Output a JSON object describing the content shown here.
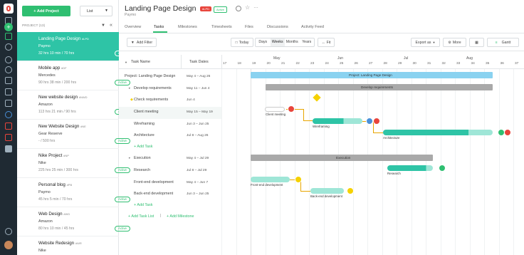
{
  "sidebar_rail": {
    "icons": [
      "logo-icon",
      "home-icon",
      "add-icon",
      "folder-icon",
      "search-icon",
      "user-icon",
      "clock-icon",
      "people-icon",
      "chart-icon",
      "calendar-icon",
      "settings-icon",
      "stop-icon",
      "layers-icon",
      "terminal-icon",
      "info-icon",
      "avatar-icon"
    ]
  },
  "projects_panel": {
    "add_project_label": "+ Add Project",
    "view_label": "List",
    "header": "PROJECT (13)",
    "projects": [
      {
        "name": "Landing Page Design",
        "tag": "#LPD",
        "client": "Paymo",
        "hours": "32 hrs 10 min / 70 hrs",
        "status": "Active"
      },
      {
        "name": "Mobile app",
        "tag": "#DF",
        "client": "Mercedes",
        "hours": "90 hrs 38 min / 200 hrs",
        "status": "Active"
      },
      {
        "name": "New website design",
        "tag": "#NWD",
        "client": "Amazon",
        "hours": "113 hrs 21 min / 90 hrs",
        "status": "Active"
      },
      {
        "name": "New Website Design",
        "tag": "#NE",
        "client": "Gear Reserve",
        "hours": "- / 500 hrs",
        "status": "Active"
      },
      {
        "name": "Nike Project",
        "tag": "#NP",
        "client": "Nike",
        "hours": "225 hrs 25 min / 300 hrs",
        "status": "Active"
      },
      {
        "name": "Personal blog",
        "tag": "#PB",
        "client": "Paymo",
        "hours": "45 hrs 5 min / 70 hrs",
        "status": "Active"
      },
      {
        "name": "Web Design",
        "tag": "#WD",
        "client": "Amazon",
        "hours": "80 hrs 10 min / 45 hrs",
        "status": "Active"
      },
      {
        "name": "Website Redesign",
        "tag": "#WR",
        "client": "Nike",
        "hours": "",
        "status": ""
      }
    ]
  },
  "header": {
    "title": "Landing Page Design",
    "tag": "#LPD",
    "status": "Active",
    "subtitle": "Paymo",
    "tabs": [
      "Overview",
      "Tasks",
      "Milestones",
      "Timesheets",
      "Files",
      "Discussions",
      "Activity Feed"
    ],
    "active_tab": "Tasks"
  },
  "toolbar": {
    "add_filter": "Add Filter",
    "today": "Today",
    "scales": [
      "Days",
      "Weeks",
      "Months",
      "Years"
    ],
    "active_scale": "Weeks",
    "fit": "Fit",
    "export": "Export as",
    "more": "More",
    "view": "Gantt"
  },
  "task_table": {
    "col_name": "Task Name",
    "col_dates": "Task Dates",
    "rows": [
      {
        "name": "Project: Landing Page Design",
        "dates": "May 4 – Aug 26",
        "level": 0
      },
      {
        "name": "Develop requirements",
        "dates": "May 11 – Jun 4",
        "level": 1
      },
      {
        "name": "Check requirements",
        "dates": "Jun 4",
        "level": 2
      },
      {
        "name": "Client meeting",
        "dates": "May 15 – May 19",
        "level": 2
      },
      {
        "name": "Wireframing",
        "dates": "Jun 3 – Jun 25",
        "level": 2
      },
      {
        "name": "Architecture",
        "dates": "Jul 8 – Aug 26",
        "level": 2
      },
      {
        "name": "+ Add Task",
        "dates": "",
        "level": 2
      },
      {
        "name": "Execution",
        "dates": "May 4 – Jul 29",
        "level": 1
      },
      {
        "name": "Research",
        "dates": "Jul 8 – Jul 29",
        "level": 2
      },
      {
        "name": "Front-end development",
        "dates": "May 4 – Jun 7",
        "level": 2
      },
      {
        "name": "Back-end development",
        "dates": "Jun 3 – Jun 25",
        "level": 2
      },
      {
        "name": "+ Add Task",
        "dates": "",
        "level": 2
      }
    ],
    "add_task_list": "+ Add Task List",
    "add_milestone": "+ Add Milestone"
  },
  "gantt": {
    "months": [
      "May",
      "Jun",
      "Jul",
      "Aug"
    ],
    "weeks": [
      "17",
      "18",
      "19",
      "20",
      "21",
      "22",
      "23",
      "24",
      "25",
      "26",
      "27",
      "28",
      "29",
      "30",
      "31",
      "32",
      "33",
      "34",
      "35",
      "36",
      "37"
    ],
    "bar_labels": {
      "project": "Project: Landing Page Design",
      "develop": "Develop requirements",
      "client": "Client meeting",
      "wire": "Wireframing",
      "arch": "Architecture",
      "execution": "Execution",
      "research": "Research",
      "frontend": "Front-end development",
      "backend": "Back-end development"
    },
    "avatars": [
      "AL",
      "AL",
      "JR",
      "GT",
      "AL",
      "GT",
      "AR"
    ],
    "colors": {
      "project": "#8ad2f0",
      "group": "#a9a9a9",
      "task": "#2ec4a6",
      "milestone": "#f5d100",
      "accent": "#2fbf71"
    }
  }
}
